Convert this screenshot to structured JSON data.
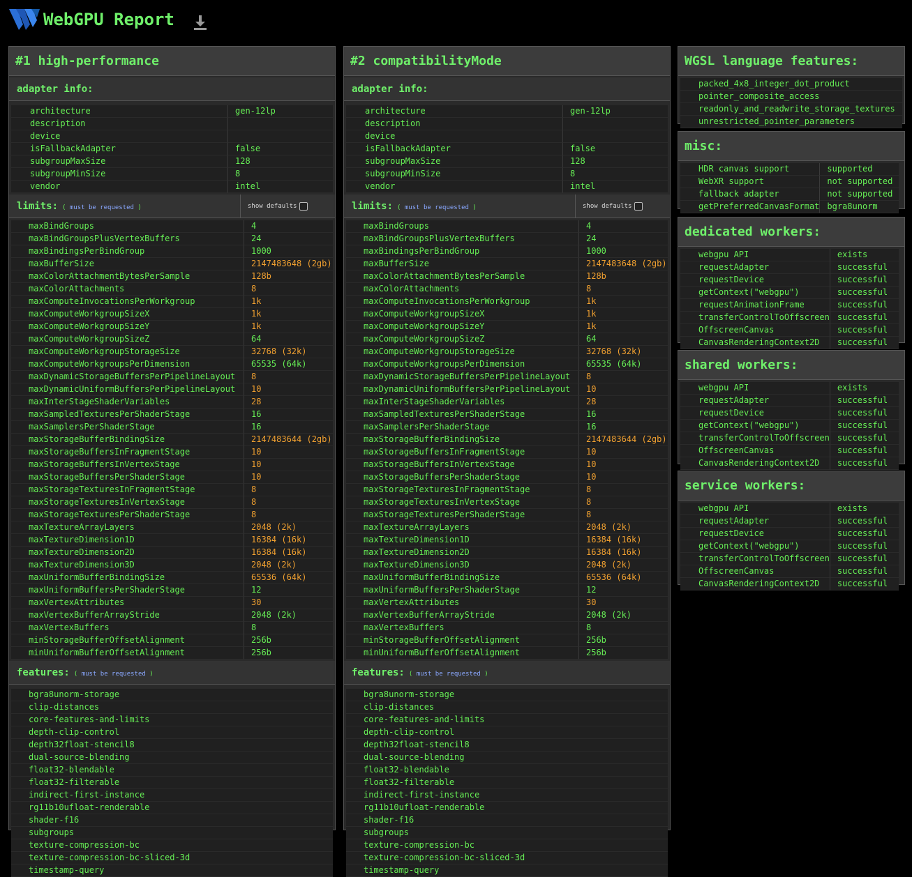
{
  "app": {
    "title": "WebGPU Report",
    "logo_icon": "webgpu-logo-icon",
    "download_icon": "download-icon"
  },
  "colors": {
    "text": "#66ee55",
    "accent_orange": "#f0a030",
    "link_blue": "#8aa8ff",
    "bg": "#000000",
    "panel": "#2a2a2a"
  },
  "adapters": [
    {
      "title": "#1 high-performance",
      "adapter_info_label": "adapter info:",
      "info": [
        {
          "k": "architecture",
          "v": "gen-12lp"
        },
        {
          "k": "description",
          "v": ""
        },
        {
          "k": "device",
          "v": ""
        },
        {
          "k": "isFallbackAdapter",
          "v": "false"
        },
        {
          "k": "subgroupMaxSize",
          "v": "128"
        },
        {
          "k": "subgroupMinSize",
          "v": "8"
        },
        {
          "k": "vendor",
          "v": "intel"
        }
      ],
      "limits_label": "limits:",
      "must_open": "(",
      "must_text": "must be requested",
      "must_close": ")",
      "show_defaults": "show defaults",
      "limits": [
        {
          "k": "maxBindGroups",
          "v": "4",
          "hl": false
        },
        {
          "k": "maxBindGroupsPlusVertexBuffers",
          "v": "24",
          "hl": false
        },
        {
          "k": "maxBindingsPerBindGroup",
          "v": "1000",
          "hl": false
        },
        {
          "k": "maxBufferSize",
          "v": "2147483648 (2gb)",
          "hl": true
        },
        {
          "k": "maxColorAttachmentBytesPerSample",
          "v": "128b",
          "hl": true
        },
        {
          "k": "maxColorAttachments",
          "v": "8",
          "hl": true
        },
        {
          "k": "maxComputeInvocationsPerWorkgroup",
          "v": "1k",
          "hl": true
        },
        {
          "k": "maxComputeWorkgroupSizeX",
          "v": "1k",
          "hl": true
        },
        {
          "k": "maxComputeWorkgroupSizeY",
          "v": "1k",
          "hl": true
        },
        {
          "k": "maxComputeWorkgroupSizeZ",
          "v": "64",
          "hl": false
        },
        {
          "k": "maxComputeWorkgroupStorageSize",
          "v": "32768 (32k)",
          "hl": true
        },
        {
          "k": "maxComputeWorkgroupsPerDimension",
          "v": "65535 (64k)",
          "hl": false
        },
        {
          "k": "maxDynamicStorageBuffersPerPipelineLayout",
          "v": "8",
          "hl": true
        },
        {
          "k": "maxDynamicUniformBuffersPerPipelineLayout",
          "v": "10",
          "hl": true
        },
        {
          "k": "maxInterStageShaderVariables",
          "v": "28",
          "hl": true
        },
        {
          "k": "maxSampledTexturesPerShaderStage",
          "v": "16",
          "hl": false
        },
        {
          "k": "maxSamplersPerShaderStage",
          "v": "16",
          "hl": false
        },
        {
          "k": "maxStorageBufferBindingSize",
          "v": "2147483644 (2gb)",
          "hl": true
        },
        {
          "k": "maxStorageBuffersInFragmentStage",
          "v": "10",
          "hl": true
        },
        {
          "k": "maxStorageBuffersInVertexStage",
          "v": "10",
          "hl": true
        },
        {
          "k": "maxStorageBuffersPerShaderStage",
          "v": "10",
          "hl": true
        },
        {
          "k": "maxStorageTexturesInFragmentStage",
          "v": "8",
          "hl": true
        },
        {
          "k": "maxStorageTexturesInVertexStage",
          "v": "8",
          "hl": true
        },
        {
          "k": "maxStorageTexturesPerShaderStage",
          "v": "8",
          "hl": true
        },
        {
          "k": "maxTextureArrayLayers",
          "v": "2048 (2k)",
          "hl": true
        },
        {
          "k": "maxTextureDimension1D",
          "v": "16384 (16k)",
          "hl": true
        },
        {
          "k": "maxTextureDimension2D",
          "v": "16384 (16k)",
          "hl": true
        },
        {
          "k": "maxTextureDimension3D",
          "v": "2048 (2k)",
          "hl": true
        },
        {
          "k": "maxUniformBufferBindingSize",
          "v": "65536 (64k)",
          "hl": true
        },
        {
          "k": "maxUniformBuffersPerShaderStage",
          "v": "12",
          "hl": false
        },
        {
          "k": "maxVertexAttributes",
          "v": "30",
          "hl": true
        },
        {
          "k": "maxVertexBufferArrayStride",
          "v": "2048 (2k)",
          "hl": false
        },
        {
          "k": "maxVertexBuffers",
          "v": "8",
          "hl": false
        },
        {
          "k": "minStorageBufferOffsetAlignment",
          "v": "256b",
          "hl": false
        },
        {
          "k": "minUniformBufferOffsetAlignment",
          "v": "256b",
          "hl": false
        }
      ],
      "features_label": "features:",
      "features": [
        "bgra8unorm-storage",
        "clip-distances",
        "core-features-and-limits",
        "depth-clip-control",
        "depth32float-stencil8",
        "dual-source-blending",
        "float32-blendable",
        "float32-filterable",
        "indirect-first-instance",
        "rg11b10ufloat-renderable",
        "shader-f16",
        "subgroups",
        "texture-compression-bc",
        "texture-compression-bc-sliced-3d",
        "timestamp-query"
      ]
    },
    {
      "title": "#2 compatibilityMode",
      "adapter_info_label": "adapter info:",
      "info": [
        {
          "k": "architecture",
          "v": "gen-12lp"
        },
        {
          "k": "description",
          "v": ""
        },
        {
          "k": "device",
          "v": ""
        },
        {
          "k": "isFallbackAdapter",
          "v": "false"
        },
        {
          "k": "subgroupMaxSize",
          "v": "128"
        },
        {
          "k": "subgroupMinSize",
          "v": "8"
        },
        {
          "k": "vendor",
          "v": "intel"
        }
      ],
      "limits_label": "limits:",
      "must_open": "(",
      "must_text": "must be requested",
      "must_close": ")",
      "show_defaults": "show defaults",
      "limits": [
        {
          "k": "maxBindGroups",
          "v": "4",
          "hl": false
        },
        {
          "k": "maxBindGroupsPlusVertexBuffers",
          "v": "24",
          "hl": false
        },
        {
          "k": "maxBindingsPerBindGroup",
          "v": "1000",
          "hl": false
        },
        {
          "k": "maxBufferSize",
          "v": "2147483648 (2gb)",
          "hl": true
        },
        {
          "k": "maxColorAttachmentBytesPerSample",
          "v": "128b",
          "hl": true
        },
        {
          "k": "maxColorAttachments",
          "v": "8",
          "hl": true
        },
        {
          "k": "maxComputeInvocationsPerWorkgroup",
          "v": "1k",
          "hl": true
        },
        {
          "k": "maxComputeWorkgroupSizeX",
          "v": "1k",
          "hl": true
        },
        {
          "k": "maxComputeWorkgroupSizeY",
          "v": "1k",
          "hl": true
        },
        {
          "k": "maxComputeWorkgroupSizeZ",
          "v": "64",
          "hl": false
        },
        {
          "k": "maxComputeWorkgroupStorageSize",
          "v": "32768 (32k)",
          "hl": true
        },
        {
          "k": "maxComputeWorkgroupsPerDimension",
          "v": "65535 (64k)",
          "hl": false
        },
        {
          "k": "maxDynamicStorageBuffersPerPipelineLayout",
          "v": "8",
          "hl": true
        },
        {
          "k": "maxDynamicUniformBuffersPerPipelineLayout",
          "v": "10",
          "hl": true
        },
        {
          "k": "maxInterStageShaderVariables",
          "v": "28",
          "hl": true
        },
        {
          "k": "maxSampledTexturesPerShaderStage",
          "v": "16",
          "hl": false
        },
        {
          "k": "maxSamplersPerShaderStage",
          "v": "16",
          "hl": false
        },
        {
          "k": "maxStorageBufferBindingSize",
          "v": "2147483644 (2gb)",
          "hl": true
        },
        {
          "k": "maxStorageBuffersInFragmentStage",
          "v": "10",
          "hl": true
        },
        {
          "k": "maxStorageBuffersInVertexStage",
          "v": "10",
          "hl": true
        },
        {
          "k": "maxStorageBuffersPerShaderStage",
          "v": "10",
          "hl": true
        },
        {
          "k": "maxStorageTexturesInFragmentStage",
          "v": "8",
          "hl": true
        },
        {
          "k": "maxStorageTexturesInVertexStage",
          "v": "8",
          "hl": true
        },
        {
          "k": "maxStorageTexturesPerShaderStage",
          "v": "8",
          "hl": true
        },
        {
          "k": "maxTextureArrayLayers",
          "v": "2048 (2k)",
          "hl": true
        },
        {
          "k": "maxTextureDimension1D",
          "v": "16384 (16k)",
          "hl": true
        },
        {
          "k": "maxTextureDimension2D",
          "v": "16384 (16k)",
          "hl": true
        },
        {
          "k": "maxTextureDimension3D",
          "v": "2048 (2k)",
          "hl": true
        },
        {
          "k": "maxUniformBufferBindingSize",
          "v": "65536 (64k)",
          "hl": true
        },
        {
          "k": "maxUniformBuffersPerShaderStage",
          "v": "12",
          "hl": false
        },
        {
          "k": "maxVertexAttributes",
          "v": "30",
          "hl": true
        },
        {
          "k": "maxVertexBufferArrayStride",
          "v": "2048 (2k)",
          "hl": false
        },
        {
          "k": "maxVertexBuffers",
          "v": "8",
          "hl": false
        },
        {
          "k": "minStorageBufferOffsetAlignment",
          "v": "256b",
          "hl": false
        },
        {
          "k": "minUniformBufferOffsetAlignment",
          "v": "256b",
          "hl": false
        }
      ],
      "features_label": "features:",
      "features": [
        "bgra8unorm-storage",
        "clip-distances",
        "core-features-and-limits",
        "depth-clip-control",
        "depth32float-stencil8",
        "dual-source-blending",
        "float32-blendable",
        "float32-filterable",
        "indirect-first-instance",
        "rg11b10ufloat-renderable",
        "shader-f16",
        "subgroups",
        "texture-compression-bc",
        "texture-compression-bc-sliced-3d",
        "timestamp-query"
      ]
    }
  ],
  "wgsl": {
    "title": "WGSL language features:",
    "items": [
      "packed_4x8_integer_dot_product",
      "pointer_composite_access",
      "readonly_and_readwrite_storage_textures",
      "unrestricted_pointer_parameters"
    ]
  },
  "misc": {
    "title": "misc:",
    "rows": [
      {
        "k": "HDR canvas support",
        "v": "supported"
      },
      {
        "k": "WebXR support",
        "v": "not supported"
      },
      {
        "k": "fallback adapter",
        "v": "not supported"
      },
      {
        "k": "getPreferredCanvasFormat",
        "v": "bgra8unorm"
      }
    ]
  },
  "workers": [
    {
      "title": "dedicated workers:",
      "rows": [
        {
          "k": "webgpu API",
          "v": "exists"
        },
        {
          "k": "requestAdapter",
          "v": "successful"
        },
        {
          "k": "requestDevice",
          "v": "successful"
        },
        {
          "k": "getContext(\"webgpu\")",
          "v": "successful"
        },
        {
          "k": "requestAnimationFrame",
          "v": "successful"
        },
        {
          "k": "transferControlToOffscreen",
          "v": "successful"
        },
        {
          "k": "OffscreenCanvas",
          "v": "successful"
        },
        {
          "k": "CanvasRenderingContext2D",
          "v": "successful"
        }
      ]
    },
    {
      "title": "shared workers:",
      "rows": [
        {
          "k": "webgpu API",
          "v": "exists"
        },
        {
          "k": "requestAdapter",
          "v": "successful"
        },
        {
          "k": "requestDevice",
          "v": "successful"
        },
        {
          "k": "getContext(\"webgpu\")",
          "v": "successful"
        },
        {
          "k": "transferControlToOffscreen",
          "v": "successful"
        },
        {
          "k": "OffscreenCanvas",
          "v": "successful"
        },
        {
          "k": "CanvasRenderingContext2D",
          "v": "successful"
        }
      ]
    },
    {
      "title": "service workers:",
      "rows": [
        {
          "k": "webgpu API",
          "v": "exists"
        },
        {
          "k": "requestAdapter",
          "v": "successful"
        },
        {
          "k": "requestDevice",
          "v": "successful"
        },
        {
          "k": "getContext(\"webgpu\")",
          "v": "successful"
        },
        {
          "k": "transferControlToOffscreen",
          "v": "successful"
        },
        {
          "k": "OffscreenCanvas",
          "v": "successful"
        },
        {
          "k": "CanvasRenderingContext2D",
          "v": "successful"
        }
      ]
    }
  ]
}
